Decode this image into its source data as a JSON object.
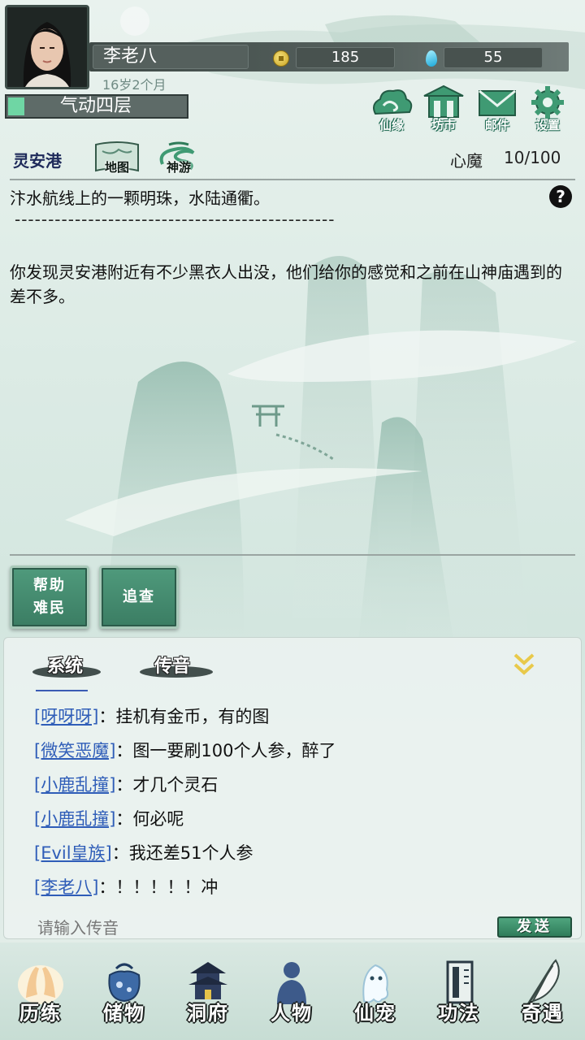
{
  "player": {
    "name": "李老八",
    "age": "16岁2个月",
    "realm": "气动四层",
    "realm_progress": 0.09
  },
  "currency": {
    "coins": "185",
    "gems": "55"
  },
  "top_menu": [
    {
      "label": "仙缘",
      "icon": "cloud-icon"
    },
    {
      "label": "坊市",
      "icon": "market-icon"
    },
    {
      "label": "邮件",
      "icon": "mail-icon"
    },
    {
      "label": "设置",
      "icon": "gear-icon"
    }
  ],
  "location": {
    "name": "灵安港",
    "map_label": "地图",
    "travel_label": "神游",
    "xinmo_label": "心魔",
    "xinmo_value": "10/100"
  },
  "description": {
    "intro": "汴水航线上的一颗明珠，水陆通衢。",
    "separator": "------------------------------------------------",
    "story": "你发现灵安港附近有不少黑衣人出没，他们给你的感觉和之前在山神庙遇到的差不多。"
  },
  "actions": [
    {
      "line1": "帮助",
      "line2": "难民"
    },
    {
      "line1": "追查",
      "line2": ""
    }
  ],
  "chat": {
    "tabs": [
      "系统",
      "传音"
    ],
    "messages": [
      {
        "user": "[呀呀呀]",
        "text": "：挂机有金币，有的图"
      },
      {
        "user": "[微笑恶魔]",
        "text": "：图一要刷100个人参，醉了"
      },
      {
        "user": "[小鹿乱撞]",
        "text": "：才几个灵石"
      },
      {
        "user": "[小鹿乱撞]",
        "text": "：何必呢"
      },
      {
        "user": "[Evil皇族]",
        "text": "：我还差51个人参"
      },
      {
        "user": "[李老八]",
        "text": "：！！！！！冲"
      }
    ],
    "input_placeholder": "请输入传音",
    "send_label": "发送"
  },
  "bottom_nav": [
    {
      "label": "历练",
      "icon": "hands-icon"
    },
    {
      "label": "储物",
      "icon": "bag-icon"
    },
    {
      "label": "洞府",
      "icon": "pagoda-icon"
    },
    {
      "label": "人物",
      "icon": "person-icon"
    },
    {
      "label": "仙宠",
      "icon": "ghost-pet-icon"
    },
    {
      "label": "功法",
      "icon": "scroll-book-icon"
    },
    {
      "label": "奇遇",
      "icon": "feather-icon"
    }
  ]
}
